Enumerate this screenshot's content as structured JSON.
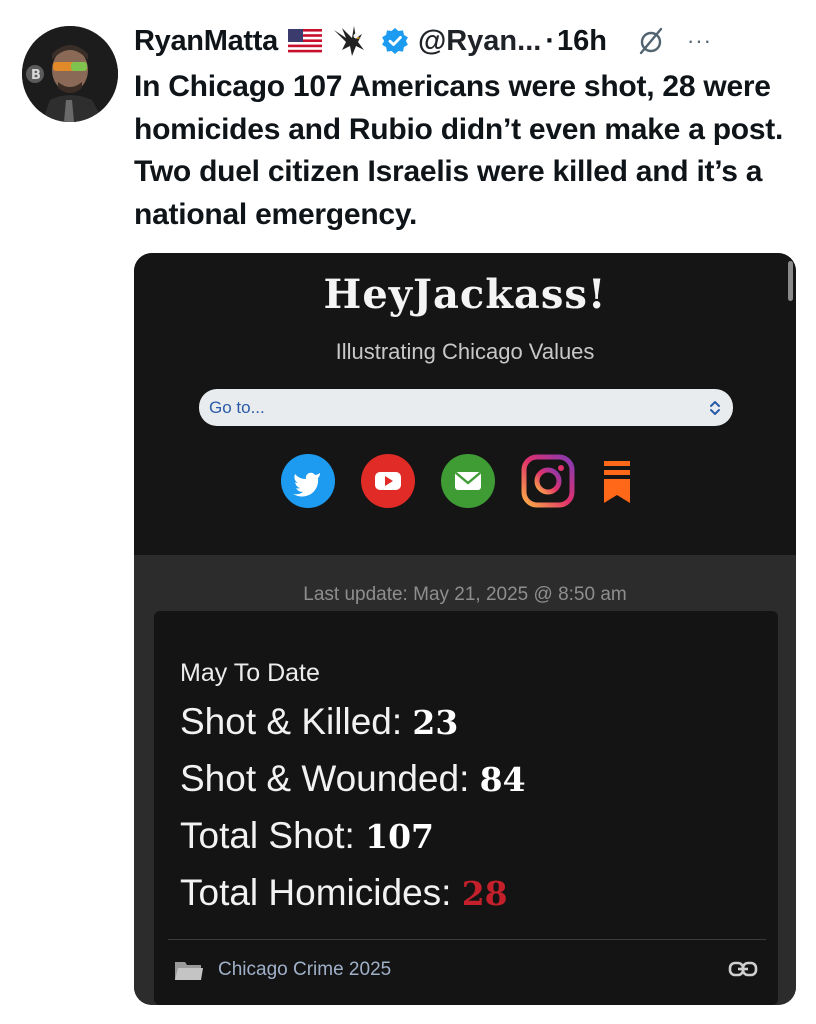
{
  "tweet": {
    "author": {
      "display_name": "RyanMatta",
      "handle": "@Ryan...",
      "separator": "·",
      "timestamp": "16h",
      "badges": [
        "us-flag-icon",
        "eagle-icon",
        "verified-badge-icon"
      ]
    },
    "more_label": "···",
    "text": "In Chicago 107 Americans were shot, 28 were homicides and Rubio didn’t even make a post. Two duel citizen Israelis were killed and it’s a national emergency.",
    "colors": {
      "verified": "#1d9bf0",
      "text": "#0f1419"
    }
  },
  "embedded_page": {
    "site_title": "HeyJackass!",
    "subtitle": "Illustrating Chicago Values",
    "goto_select": {
      "selected": "Go to..."
    },
    "social_icons": [
      {
        "name": "twitter-icon",
        "color": "#1d9bf0"
      },
      {
        "name": "youtube-icon",
        "color": "#e02b26"
      },
      {
        "name": "email-icon",
        "color": "#3f9c35"
      },
      {
        "name": "instagram-icon",
        "color": "#e1306c"
      },
      {
        "name": "substack-icon",
        "color": "#ff6719"
      }
    ],
    "last_update": "Last update: May 21, 2025 @ 8:50 am",
    "stats": {
      "heading": "May To Date",
      "items": [
        {
          "label": "Shot & Killed:",
          "value": "23"
        },
        {
          "label": "Shot & Wounded:",
          "value": "84"
        },
        {
          "label": "Total Shot:",
          "value": "107"
        },
        {
          "label": "Total Homicides:",
          "value": "28",
          "color": "#c4202b"
        }
      ]
    },
    "category": {
      "label": "Chicago Crime 2025"
    }
  }
}
